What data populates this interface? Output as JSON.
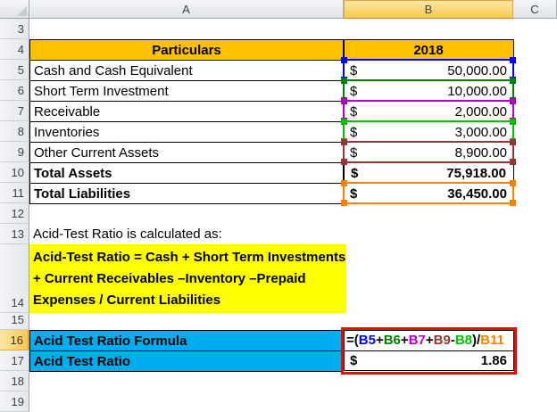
{
  "sheet": {
    "column_labels": [
      "A",
      "B",
      "C"
    ],
    "selected_column": "B",
    "row_labels": [
      "3",
      "4",
      "5",
      "6",
      "7",
      "8",
      "9",
      "10",
      "11",
      "12",
      "13",
      "14",
      "15",
      "16",
      "17",
      "18",
      "19"
    ],
    "selected_row": "16"
  },
  "colors": {
    "table_header_fill": "#FFC000",
    "note_highlight": "#FFFF00",
    "label_fill": "#00AEEF",
    "annotation_border": "#FF0000"
  },
  "table": {
    "header": {
      "particulars": "Particulars",
      "year": "2018"
    },
    "line_items": [
      {
        "label": "Cash and Cash Equivalent",
        "currency": "$",
        "amount": "50,000.00",
        "ref_color": "#0000FF"
      },
      {
        "label": "Short Term Investment",
        "currency": "$",
        "amount": "10,000.00",
        "ref_color": "#008000"
      },
      {
        "label": "Receivable",
        "currency": "$",
        "amount": "2,000.00",
        "ref_color": "#B100C8"
      },
      {
        "label": "Inventories",
        "currency": "$",
        "amount": "3,000.00",
        "ref_color": "#00C000"
      },
      {
        "label": "Other Current Assets",
        "currency": "$",
        "amount": "8,900.00",
        "ref_color": "#963634"
      }
    ],
    "totals": [
      {
        "label": "Total Assets",
        "currency": "$",
        "amount": "75,918.00"
      },
      {
        "label": "Total Liabilities",
        "currency": "$",
        "amount": "36,450.00",
        "ref_color": "#FF7F00"
      }
    ]
  },
  "notes": {
    "intro": "Acid-Test Ratio is calculated as:",
    "formula_lines": [
      "Acid-Test Ratio = Cash + Short Term Investments",
      "+ Current Receivables –Inventory –Prepaid",
      "Expenses / Current Liabilities"
    ]
  },
  "calc": {
    "formula_label": "Acid Test Ratio Formula",
    "formula_tokens": [
      {
        "text": "=(",
        "color": "#000000"
      },
      {
        "text": "B5",
        "color": "#0000FF"
      },
      {
        "text": "+",
        "color": "#000000"
      },
      {
        "text": "B6",
        "color": "#008000"
      },
      {
        "text": "+",
        "color": "#000000"
      },
      {
        "text": "B7",
        "color": "#B100C8"
      },
      {
        "text": "+",
        "color": "#000000"
      },
      {
        "text": "B9",
        "color": "#963634"
      },
      {
        "text": "-",
        "color": "#000000"
      },
      {
        "text": "B8",
        "color": "#00C000"
      },
      {
        "text": ")/",
        "color": "#000000"
      },
      {
        "text": "B11",
        "color": "#FF7F00"
      }
    ],
    "result_label": "Acid Test Ratio",
    "result_currency": "$",
    "result_value": "1.86"
  }
}
